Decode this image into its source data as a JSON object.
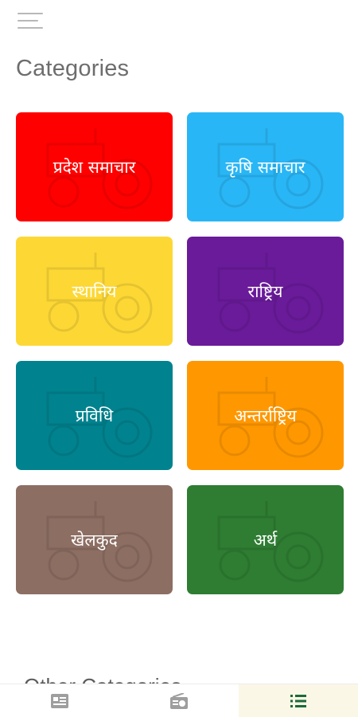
{
  "header": {
    "title": "Categories"
  },
  "categories": [
    {
      "label": "प्रदेश समाचार",
      "color": "#ff0000"
    },
    {
      "label": "कृषि समाचार",
      "color": "#29b6f6"
    },
    {
      "label": "स्थानिय",
      "color": "#fdd835"
    },
    {
      "label": "राष्ट्रिय",
      "color": "#6a1b9a"
    },
    {
      "label": "प्रविधि",
      "color": "#00838f"
    },
    {
      "label": "अन्तर्राष्ट्रिय",
      "color": "#ff9800"
    },
    {
      "label": "खेलकुद",
      "color": "#8d6e63"
    },
    {
      "label": "अर्थ",
      "color": "#2e7d32"
    }
  ],
  "other": {
    "title": "Other Categories"
  },
  "bottom_nav": [
    {
      "icon": "news-card-icon",
      "active": false
    },
    {
      "icon": "radio-icon",
      "active": false
    },
    {
      "icon": "list-icon",
      "active": true
    }
  ],
  "colors": {
    "active_nav": "#1b6b3a",
    "inactive_nav": "#9e9e9e"
  }
}
